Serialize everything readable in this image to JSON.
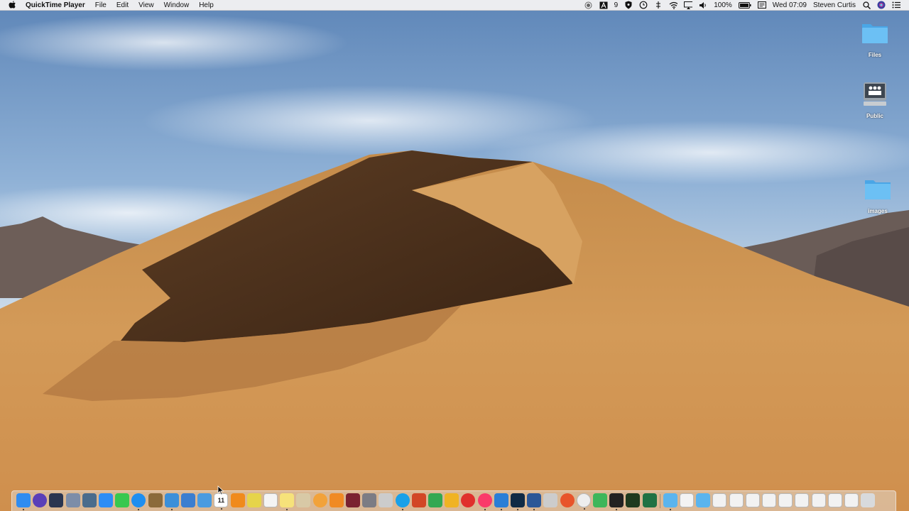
{
  "menubar": {
    "app_name": "QuickTime Player",
    "items": [
      "File",
      "Edit",
      "View",
      "Window",
      "Help"
    ],
    "status": {
      "adobe_count": "9",
      "battery": "100%",
      "clock": "Wed 07:09",
      "user": "Steven Curtis"
    }
  },
  "desktop": {
    "icons": [
      {
        "label": "Files",
        "icon": "folder-icon"
      },
      {
        "label": "Public",
        "icon": "shared-drive-icon"
      },
      {
        "label": "images",
        "icon": "folder-icon"
      }
    ]
  },
  "dock": {
    "calendar_day": "11",
    "apps": [
      {
        "name": "finder",
        "color": "#2f8cf0"
      },
      {
        "name": "siri",
        "color": "#5a3fb8"
      },
      {
        "name": "quicktime",
        "color": "#2a3550"
      },
      {
        "name": "launchpad",
        "color": "#7d8da8"
      },
      {
        "name": "preview",
        "color": "#4a6c8c"
      },
      {
        "name": "app-store",
        "color": "#2d8df5"
      },
      {
        "name": "messages",
        "color": "#38c84f"
      },
      {
        "name": "safari",
        "color": "#1e8ef0"
      },
      {
        "name": "notebook",
        "color": "#8b6a3a"
      },
      {
        "name": "xcode",
        "color": "#3b8fd9"
      },
      {
        "name": "xcode-beta",
        "color": "#3a7ed0"
      },
      {
        "name": "instruments",
        "color": "#4a9be0"
      },
      {
        "name": "calendar",
        "color": "#ffffff"
      },
      {
        "name": "vlc",
        "color": "#f08a1c"
      },
      {
        "name": "stickies",
        "color": "#e6d44a"
      },
      {
        "name": "textedit",
        "color": "#f4f4f4"
      },
      {
        "name": "notes",
        "color": "#f6e27a"
      },
      {
        "name": "contacts",
        "color": "#d8c9a6"
      },
      {
        "name": "photos",
        "color": "#f2a23a"
      },
      {
        "name": "books",
        "color": "#f08a24"
      },
      {
        "name": "photo-booth",
        "color": "#7a2230"
      },
      {
        "name": "system-preferences",
        "color": "#7c7c84"
      },
      {
        "name": "help",
        "color": "#cccccc"
      },
      {
        "name": "skype",
        "color": "#1aa0e8"
      },
      {
        "name": "powerpoint",
        "color": "#d24726"
      },
      {
        "name": "xmind",
        "color": "#33a852"
      },
      {
        "name": "slack",
        "color": "#f0b323"
      },
      {
        "name": "no-entry",
        "color": "#e0302c"
      },
      {
        "name": "itunes",
        "color": "#fa3a6a"
      },
      {
        "name": "vscode",
        "color": "#2a7ed6"
      },
      {
        "name": "photoshop",
        "color": "#0f2a45"
      },
      {
        "name": "word",
        "color": "#2b5797"
      },
      {
        "name": "help-2",
        "color": "#cccccc"
      },
      {
        "name": "compass",
        "color": "#e8542a"
      },
      {
        "name": "chrome",
        "color": "#eeeeee"
      },
      {
        "name": "sheets",
        "color": "#3eb65a"
      },
      {
        "name": "terminal",
        "color": "#222222"
      },
      {
        "name": "console",
        "color": "#1e3a1e"
      },
      {
        "name": "excel",
        "color": "#1f7244"
      }
    ],
    "stacks": [
      {
        "name": "downloads-folder",
        "color": "#5ab4ee"
      },
      {
        "name": "tutorial-app",
        "color": "#f3f3f3"
      },
      {
        "name": "documents-folder",
        "color": "#5ab4ee"
      },
      {
        "name": "recent-1",
        "color": "#f2f2f2"
      },
      {
        "name": "recent-2",
        "color": "#f2f2f2"
      },
      {
        "name": "recent-3",
        "color": "#f2f2f2"
      },
      {
        "name": "recent-4",
        "color": "#f2f2f2"
      },
      {
        "name": "recent-5",
        "color": "#f2f2f2"
      },
      {
        "name": "recent-6",
        "color": "#f2f2f2"
      },
      {
        "name": "recent-7",
        "color": "#f2f2f2"
      },
      {
        "name": "recent-8",
        "color": "#f2f2f2"
      },
      {
        "name": "recent-9",
        "color": "#f2f2f2"
      },
      {
        "name": "trash",
        "color": "#d8dadc"
      }
    ]
  }
}
